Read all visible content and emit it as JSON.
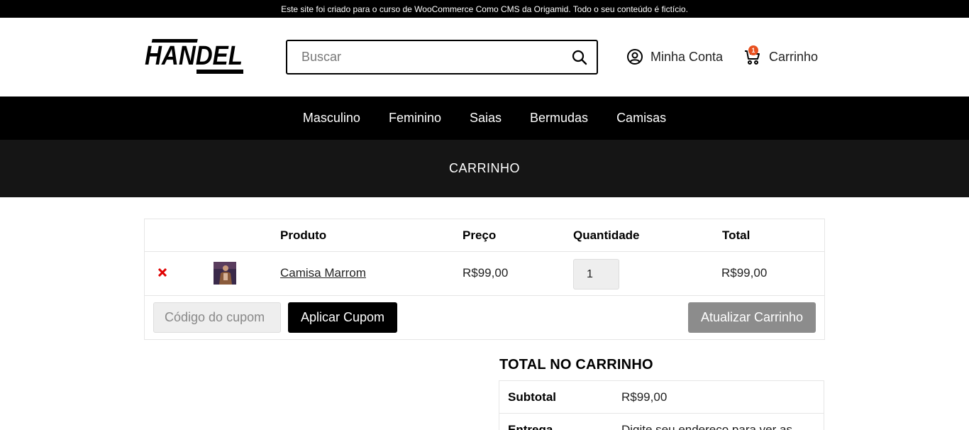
{
  "notice": "Este site foi criado para o curso de WooCommerce Como CMS da Origamid. Todo o seu conteúdo é fictício.",
  "header": {
    "logo_text": "HANDEL",
    "search_placeholder": "Buscar",
    "account_label": "Minha Conta",
    "cart_label": "Carrinho",
    "cart_count": "1"
  },
  "nav": [
    "Masculino",
    "Feminino",
    "Saias",
    "Bermudas",
    "Camisas"
  ],
  "page_title": "CARRINHO",
  "cart": {
    "headers": {
      "product": "Produto",
      "price": "Preço",
      "quantity": "Quantidade",
      "total": "Total"
    },
    "items": [
      {
        "name": "Camisa Marrom",
        "price": "R$99,00",
        "quantity": "1",
        "total": "R$99,00"
      }
    ],
    "coupon_placeholder": "Código do cupom",
    "apply_coupon": "Aplicar Cupom",
    "update_cart": "Atualizar Carrinho"
  },
  "totals": {
    "title": "TOTAL NO CARRINHO",
    "rows": [
      {
        "label": "Subtotal",
        "value": "R$99,00"
      },
      {
        "label": "Entrega",
        "value": "Digite seu endereço para ver as"
      }
    ]
  },
  "colors": {
    "badge": "#e8501f",
    "remove": "#e00000",
    "update_button": "#8c8c8c",
    "title_bar": "#151515"
  },
  "icons": {
    "search": "search-icon",
    "account": "user-circle-icon",
    "cart": "cart-icon",
    "remove": "remove-x-icon"
  }
}
